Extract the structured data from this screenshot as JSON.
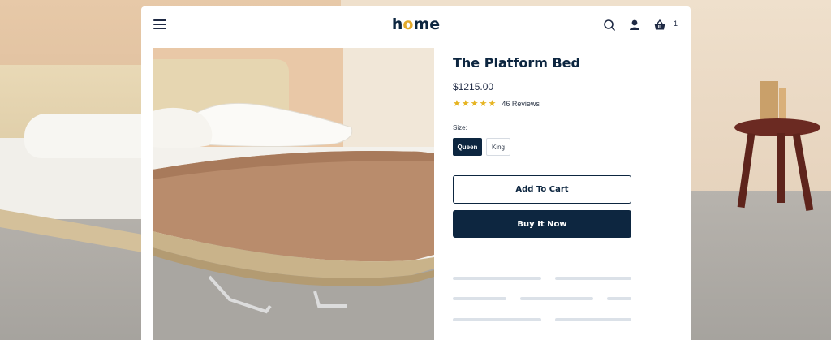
{
  "header": {
    "logo_prefix": "h",
    "logo_o": "o",
    "logo_suffix": "me",
    "cart_count": "1",
    "icons": [
      "menu-icon",
      "search-icon",
      "user-icon",
      "cart-icon"
    ]
  },
  "product": {
    "title": "The Platform Bed",
    "price": "$1215.00",
    "stars": "★★★★★",
    "reviews": "46 Reviews",
    "size_label": "Size:",
    "sizes": [
      {
        "label": "Queen",
        "selected": true
      },
      {
        "label": "King",
        "selected": false
      }
    ],
    "add_to_cart_label": "Add To Cart",
    "buy_now_label": "Buy It Now"
  },
  "colors": {
    "navy": "#0d2640",
    "accent": "#e3a92a",
    "star": "#e6b422",
    "skeleton": "#dbe1e8"
  }
}
